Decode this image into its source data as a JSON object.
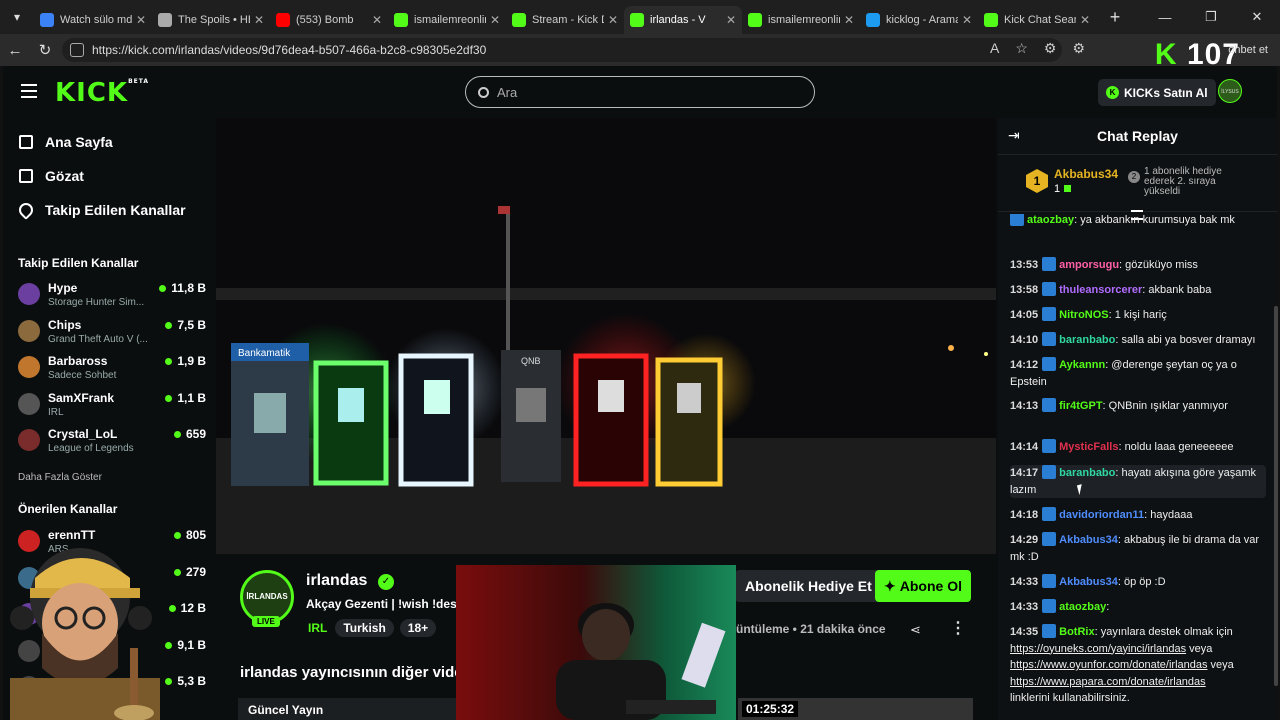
{
  "browser": {
    "tabs": [
      {
        "title": "Watch sülo md |",
        "color": "#3b82f6"
      },
      {
        "title": "The Spoils • HB",
        "color": "#aaaaaa"
      },
      {
        "title": "(553) Bomb",
        "color": "#ff0000"
      },
      {
        "title": "ismailemreonlin",
        "color": "#53fc18"
      },
      {
        "title": "Stream - Kick D",
        "color": "#53fc18"
      },
      {
        "title": "irlandas - V",
        "color": "#53fc18",
        "active": true
      },
      {
        "title": "ismailemreonlin",
        "color": "#53fc18"
      },
      {
        "title": "kicklog - Arama",
        "color": "#1d9bf0"
      },
      {
        "title": "Kick Chat Searc",
        "color": "#53fc18"
      }
    ],
    "url": "https://kick.com/irlandas/videos/9d76dea4-b507-466a-b2c8-c98305e2df30",
    "overlay_logo_k": "K",
    "overlay_logo_num": "107",
    "overlay_right_text": "ohbet et"
  },
  "site": {
    "logo": "KICK",
    "logo_beta": "BETA",
    "search_placeholder": "Ara",
    "kicks_button": "KICKs Satın Al",
    "avatar_text": "İLYSUS"
  },
  "sidebar": {
    "links": [
      "Ana Sayfa",
      "Gözat",
      "Takip Edilen Kanallar"
    ],
    "followed_heading": "Takip Edilen Kanallar",
    "followed": [
      {
        "name": "Hype",
        "game": "Storage Hunter Sim...",
        "viewers": "11,8 B",
        "color": "#6b3fa0"
      },
      {
        "name": "Chips",
        "game": "Grand Theft Auto V (...",
        "viewers": "7,5 B",
        "color": "#8b6a3e"
      },
      {
        "name": "Barbaross",
        "game": "Sadece Sohbet",
        "viewers": "1,9 B",
        "color": "#c0762c"
      },
      {
        "name": "SamXFrank",
        "game": "IRL",
        "viewers": "1,1 B",
        "color": "#555555"
      },
      {
        "name": "Crystal_LoL",
        "game": "League of Legends",
        "viewers": "659",
        "color": "#7a2c2c"
      }
    ],
    "show_more": "Daha Fazla Göster",
    "recommended_heading": "Önerilen Kanallar",
    "recommended": [
      {
        "name": "erennTT",
        "game": "ARS",
        "viewers": "805",
        "color": "#cc2222"
      },
      {
        "name": "",
        "game": "tion II",
        "viewers": "279",
        "color": "#3a6b8a"
      },
      {
        "name": "",
        "game": "ul",
        "viewers": "12 B",
        "color": "#6b3fa0"
      },
      {
        "name": "S",
        "game": "",
        "viewers": "9,1 B",
        "color": "#444444"
      },
      {
        "name": "",
        "game": "",
        "viewers": "5,3 B",
        "color": "#444444"
      }
    ]
  },
  "video": {
    "atm_label": "Bankamatik",
    "qnb_label": "QNB"
  },
  "channel": {
    "name": "irlandas",
    "avatar_text": "İRLANDAS",
    "live": "LIVE",
    "title": "Akçay Gezenti | !wish !dest",
    "lang": "IRL",
    "tags": [
      "Turkish",
      "18+"
    ],
    "gift_button": "Abonelik Hediye Et",
    "subscribe_button": "Abone Ol",
    "meta_views": "üntüleme",
    "meta_time": "21 dakika önce",
    "other_videos": "irlandas yayıncısının diğer vide",
    "current_stream": "Güncel Yayın",
    "duration": "01:25:32"
  },
  "chat": {
    "title": "Chat Replay",
    "pinned": {
      "rank": "1",
      "user": "Akbabus34",
      "count": "1",
      "note": "1 abonelik hediye ederek 2. sıraya yükseldi"
    },
    "messages": [
      {
        "time": "",
        "user": "ataozbay",
        "ucolor": "#53fc18",
        "text": ": ya akbankın kurumsuya bak mk"
      },
      {
        "time": "13:53",
        "user": "amporsugu",
        "ucolor": "#ff5fa8",
        "text": ": gözüküyo miss"
      },
      {
        "time": "13:58",
        "user": "thuleansorcerer",
        "ucolor": "#b06cff",
        "text": ": akbank baba"
      },
      {
        "time": "14:05",
        "user": "NitroNOS",
        "ucolor": "#53fc18",
        "text": ": 1 kişi hariç"
      },
      {
        "time": "14:10",
        "user": "baranbabo",
        "ucolor": "#2fd8a0",
        "text": ": salla abi ya bosver dramayı"
      },
      {
        "time": "14:12",
        "user": "Aykannn",
        "ucolor": "#53fc18",
        "text": ": @derenge şeytan oç ya o Epstein"
      },
      {
        "time": "14:13",
        "user": "fir4tGPT",
        "ucolor": "#53fc18",
        "text": ": QNBnin ışıklar yanmıyor"
      },
      {
        "time": "14:14",
        "user": "MysticFalls",
        "ucolor": "#e0304e",
        "text": ": noldu laaa geneeeeee"
      },
      {
        "time": "14:17",
        "user": "baranbabo",
        "ucolor": "#2fd8a0",
        "text": ": hayatı akışına göre yaşamk lazım"
      },
      {
        "time": "14:18",
        "user": "davidoriordan11",
        "ucolor": "#4f8dff",
        "text": ": haydaaa"
      },
      {
        "time": "14:29",
        "user": "Akbabus34",
        "ucolor": "#4f8dff",
        "text": ": akbabuş ile bi drama da var mk :D"
      },
      {
        "time": "14:33",
        "user": "Akbabus34",
        "ucolor": "#4f8dff",
        "text": ": öp öp :D"
      },
      {
        "time": "14:33",
        "user": "ataozbay",
        "ucolor": "#53fc18",
        "text": ":"
      },
      {
        "time": "14:35",
        "user": "BotRix",
        "ucolor": "#53fc18",
        "text": ": yayınlara destek olmak için"
      }
    ],
    "botrix_links": [
      "https://oyuneks.com/yayinci/irlandas",
      "https://www.oyunfor.com/donate/irlandas",
      "https://www.papara.com/donate/irlandas"
    ],
    "botrix_link_suffix_1": " veya",
    "botrix_link_suffix_2": " veya",
    "botrix_tail": "linklerini kullanabilirsiniz."
  }
}
